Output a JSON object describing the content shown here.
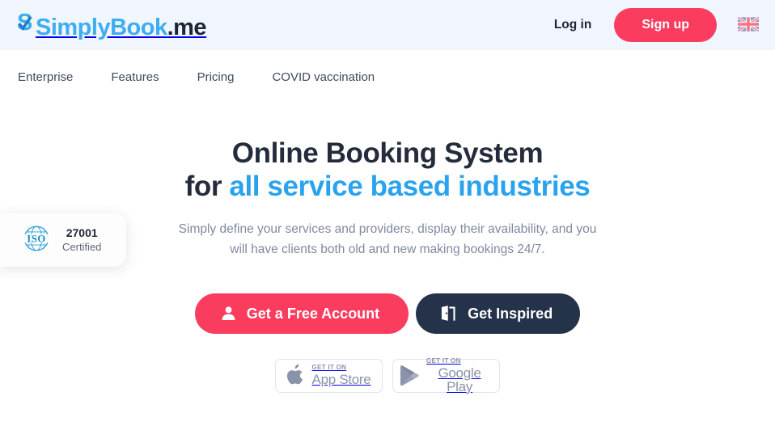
{
  "header": {
    "logo": {
      "part_blue": "SimplyBook",
      "part_dark": ".me",
      "s_letter": "S",
      "icon_name": "checkmark-s-logo-icon"
    },
    "login_label": "Log in",
    "signup_label": "Sign up",
    "language_flag": "united-kingdom-flag",
    "bg_color": "#f1f5fe",
    "accent_color": "#fa3c5f"
  },
  "nav": {
    "items": [
      {
        "label": "Enterprise"
      },
      {
        "label": "Features"
      },
      {
        "label": "Pricing"
      },
      {
        "label": "COVID vaccination"
      }
    ]
  },
  "iso_badge": {
    "icon_name": "iso-globe-icon",
    "icon_label": "ISO",
    "number": "27001",
    "certified": "Certified",
    "color": "#1b8ac4"
  },
  "hero": {
    "title_line1": "Online Booking System",
    "title_line2_prefix": "for ",
    "title_line2_accent": "all service based industries",
    "accent_color": "#2aa3ef",
    "subtitle_line1": "Simply define your services and providers, display their availability, and",
    "subtitle_line2": "you will have clients both old and new making bookings 24/7.",
    "cta_primary": {
      "label": "Get a Free Account",
      "icon_name": "user-icon",
      "color": "#fa3c5f"
    },
    "cta_secondary": {
      "label": "Get Inspired",
      "icon_name": "open-door-icon",
      "color": "#25334a"
    }
  },
  "store_badges": [
    {
      "icon_name": "apple-icon",
      "small_text": "GET IT ON",
      "large_text": "App Store"
    },
    {
      "icon_name": "google-play-icon",
      "small_text": "GET IT ON",
      "large_text": "Google Play"
    }
  ]
}
